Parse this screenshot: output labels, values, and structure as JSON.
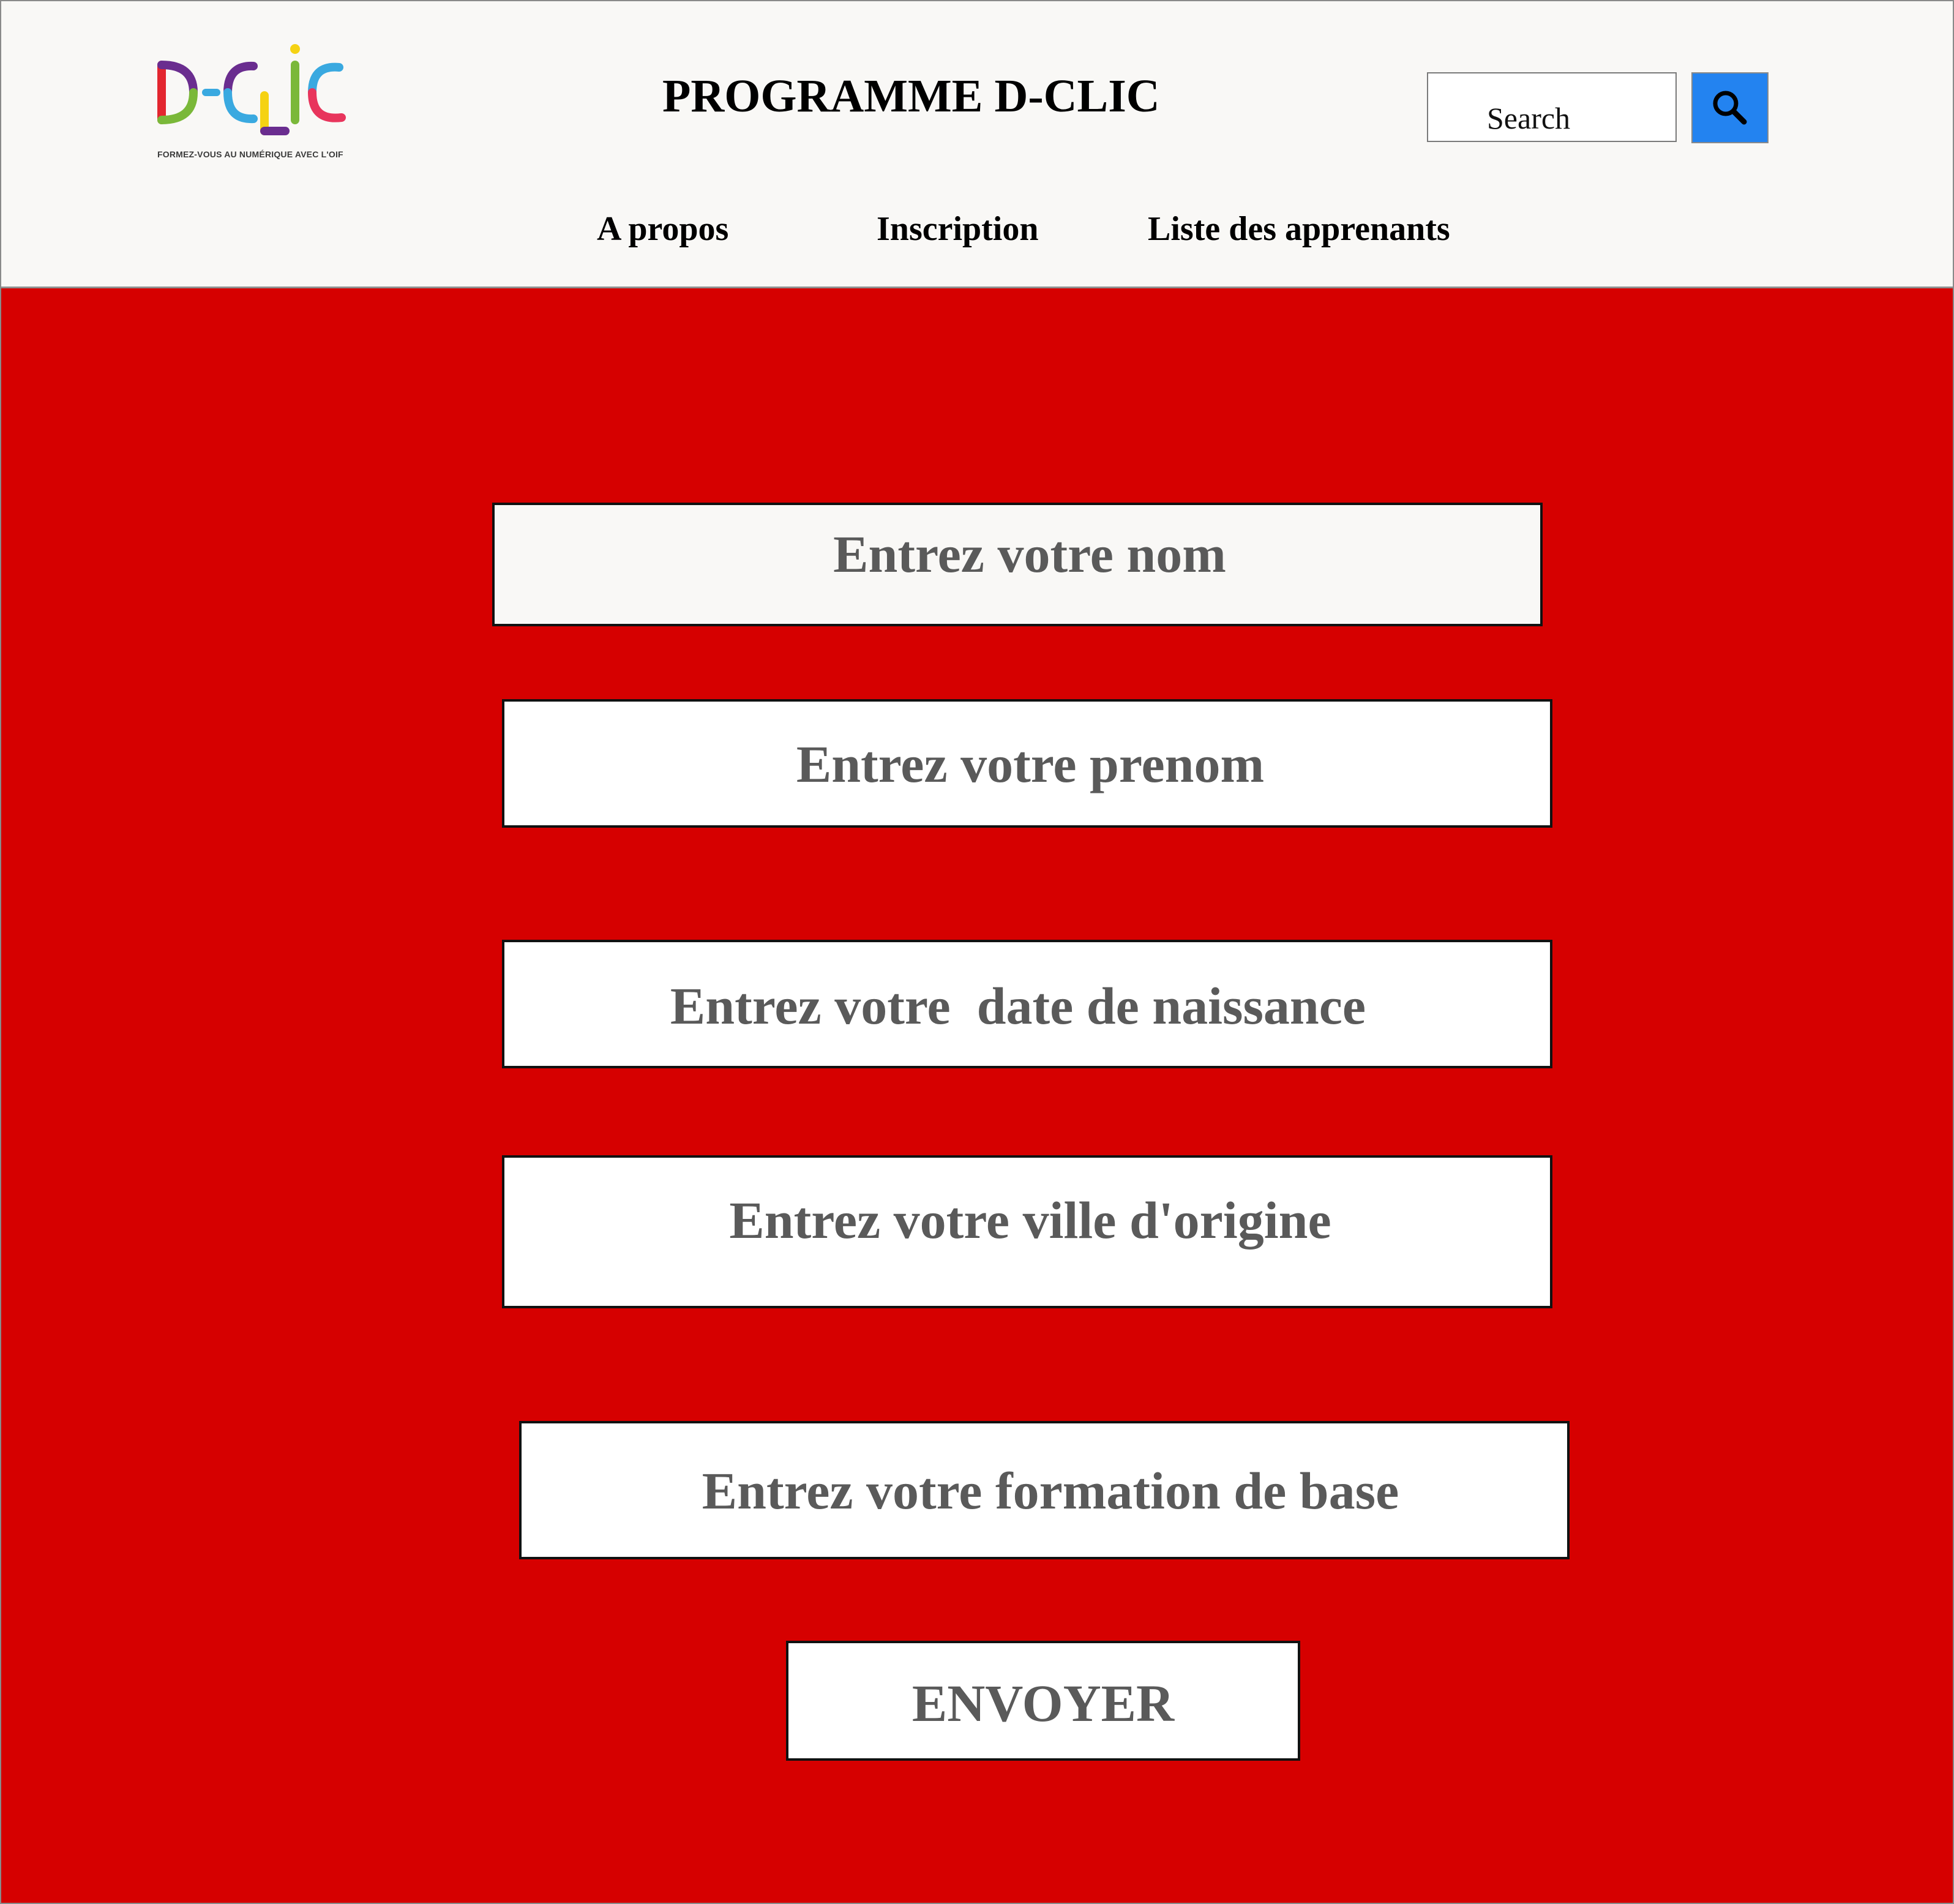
{
  "header": {
    "logo": {
      "wordmark": "D-CLIC",
      "tagline": "FORMEZ-VOUS AU NUMÉRIQUE AVEC L'OIF",
      "colors": {
        "red": "#e3262f",
        "green": "#7ab839",
        "purple": "#6a2d8f",
        "blue": "#3aa9e0",
        "yellow": "#f5d213",
        "pink": "#e8355c"
      }
    },
    "title": "PROGRAMME D-CLIC",
    "search": {
      "placeholder": "Search",
      "button_icon": "search-icon",
      "button_color": "#2383f0"
    },
    "nav": [
      {
        "label": "A propos"
      },
      {
        "label": "Inscription"
      },
      {
        "label": "Liste des apprenants"
      }
    ]
  },
  "form": {
    "background_color": "#d60000",
    "fields": [
      {
        "placeholder": "Entrez votre nom"
      },
      {
        "placeholder": "Entrez votre prenom"
      },
      {
        "placeholder": "Entrez votre  date de naissance"
      },
      {
        "placeholder": "Entrez votre ville d'origine"
      },
      {
        "placeholder": "Entrez votre formation de base"
      }
    ],
    "submit_label": "ENVOYER"
  }
}
